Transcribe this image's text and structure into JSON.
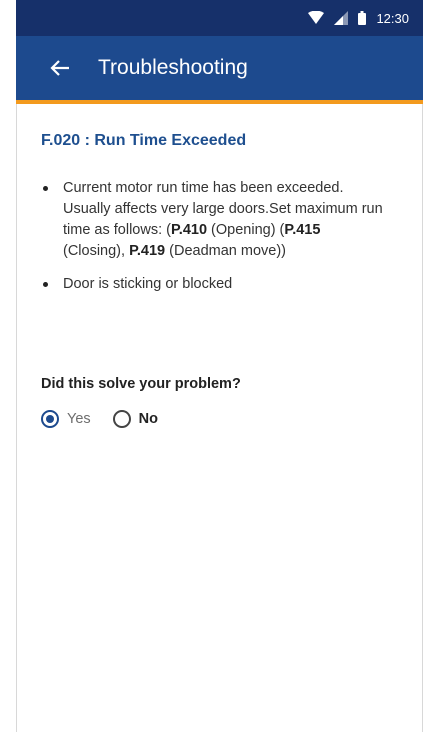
{
  "status_bar": {
    "time": "12:30"
  },
  "app_bar": {
    "title": "Troubleshooting"
  },
  "fault": {
    "title": "F.020 : Run Time Exceeded",
    "bullet1": {
      "part1": "Current motor run time has been exceeded. Usually affects very large doors.Set maximum run time as follows: (",
      "code1": "P.410",
      "part2": " (Opening) (",
      "code2": "P.415",
      "part3": " (Closing), ",
      "code3": "P.419",
      "part4": " (Deadman move))"
    },
    "bullet2": "Door is sticking or blocked"
  },
  "feedback": {
    "question": "Did this solve your problem?",
    "yes_label": "Yes",
    "no_label": "No",
    "selected": "Yes"
  },
  "colors": {
    "status_bar": "#16306a",
    "app_bar": "#1d4a8e",
    "accent": "#f39a1e",
    "title_text": "#1e4f8f"
  }
}
